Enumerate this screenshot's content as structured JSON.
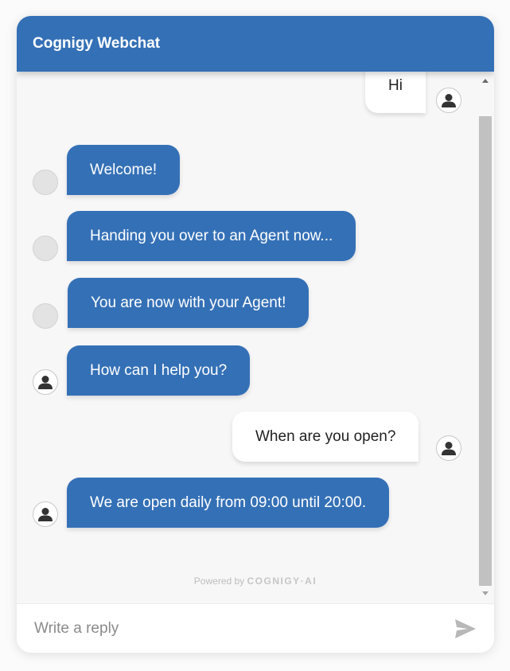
{
  "header": {
    "title": "Cognigy Webchat"
  },
  "messages": [
    {
      "source": "user",
      "text": "Hi",
      "avatar": "person-icon"
    },
    {
      "source": "bot",
      "text": "Welcome!",
      "avatar": "blank"
    },
    {
      "source": "bot",
      "text": "Handing you over to an Agent now...",
      "avatar": "blank"
    },
    {
      "source": "bot",
      "text": "You are now with your Agent!",
      "avatar": "blank"
    },
    {
      "source": "agent",
      "text": "How can I help you?",
      "avatar": "person-icon"
    },
    {
      "source": "user",
      "text": "When are you open?",
      "avatar": "person-icon"
    },
    {
      "source": "agent",
      "text": "We are open daily from 09:00 until 20:00.",
      "avatar": "person-icon"
    }
  ],
  "branding": {
    "prefix": "Powered by",
    "brand": "COGNIGY·AI"
  },
  "input": {
    "placeholder": "Write a reply",
    "value": ""
  },
  "send": {
    "icon": "send-icon"
  },
  "colors": {
    "header": "#3470b6",
    "bot_bubble": "#3470b6",
    "user_bubble": "#ffffff",
    "background": "#f7f7f8"
  }
}
